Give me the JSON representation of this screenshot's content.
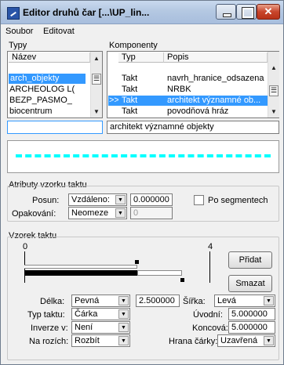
{
  "window": {
    "title": "Editor druhů čar [...\\UP_lin..."
  },
  "menu": {
    "file": "Soubor",
    "edit": "Editovat"
  },
  "types": {
    "group_label": "Typy",
    "column": "Název",
    "items": [
      "arch_objekty",
      "ARCHEOLOG L(",
      "BEZP_PASMO_",
      "biocentrum"
    ],
    "selected_value": "arch_objekty"
  },
  "components": {
    "group_label": "Komponenty",
    "col_type": "Typ",
    "col_desc": "Popis",
    "marker": ">>",
    "rows": [
      {
        "type": "Takt",
        "desc": "navrh_hranice_odsazena"
      },
      {
        "type": "Takt",
        "desc": "NRBK"
      },
      {
        "type": "Takt",
        "desc": "architekt významné ob..."
      },
      {
        "type": "Takt",
        "desc": "povodňová hráz"
      }
    ],
    "selected_desc": "architekt významné objekty"
  },
  "attrs": {
    "group_label": "Atributy vzorku taktu",
    "offset_label": "Posun:",
    "offset_mode": "Vzdáleno:",
    "offset_value": "0.000000",
    "per_segment_label": "Po segmentech",
    "repeat_label": "Opakování:",
    "repeat_mode": "Neomeze",
    "repeat_value": "0"
  },
  "pattern": {
    "group_label": "Vzorek taktu",
    "ruler_start": "0",
    "ruler_end": "4",
    "add_button": "Přidat",
    "delete_button": "Smazat",
    "length_label": "Délka:",
    "length_mode": "Pevná",
    "length_value": "2.500000",
    "width_label": "Šířka:",
    "width_mode": "Levá",
    "dash_type_label": "Typ taktu:",
    "dash_type": "Čárka",
    "start_label": "Úvodní:",
    "start_value": "5.000000",
    "inverse_label": "Inverze v:",
    "inverse_value": "Není",
    "end_label": "Koncová:",
    "end_value": "5.000000",
    "corners_label": "Na rozích:",
    "corners_value": "Rozbít",
    "edge_label": "Hrana čárky:",
    "edge_value": "Uzavřená"
  },
  "colors": {
    "preview_line": "#00ffff",
    "selection": "#3399ff"
  }
}
